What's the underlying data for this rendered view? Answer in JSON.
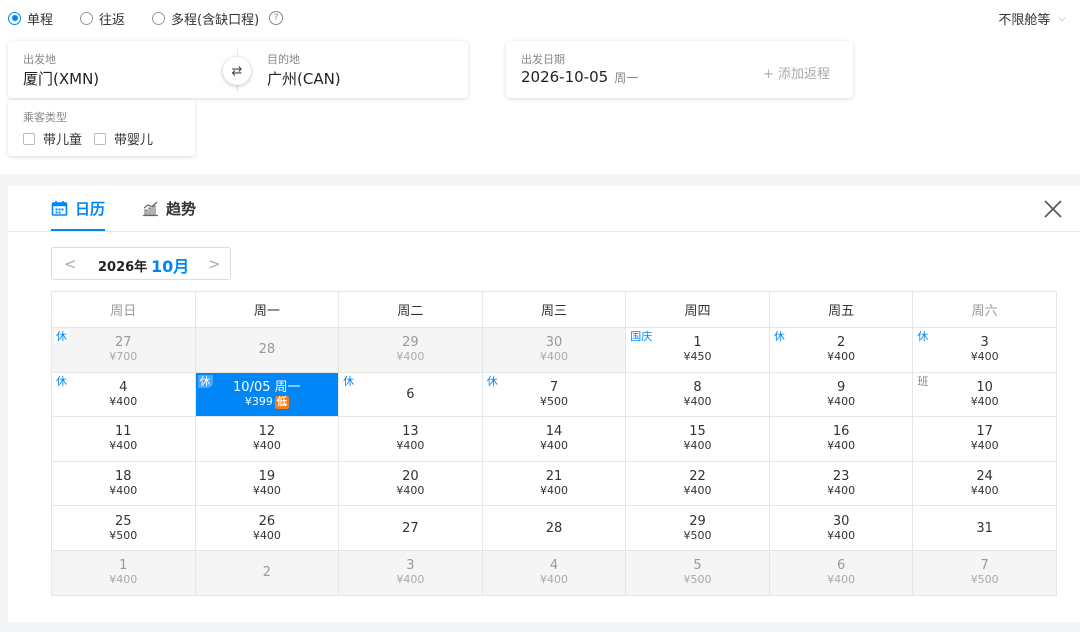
{
  "trip_types": [
    {
      "label": "单程",
      "selected": true
    },
    {
      "label": "往返",
      "selected": false
    },
    {
      "label": "多程(含缺口程)",
      "selected": false
    }
  ],
  "help_glyph": "?",
  "cabin": {
    "label": "不限舱等",
    "chevron": "⌵"
  },
  "route": {
    "from_label": "出发地",
    "from_value": "厦门(XMN)",
    "to_label": "目的地",
    "to_value": "广州(CAN)",
    "swap_glyph": "⇄"
  },
  "dates": {
    "depart_label": "出发日期",
    "depart_value": "2026-10-05",
    "depart_weekday": "周一",
    "add_return": "+ 添加返程"
  },
  "passengers": {
    "label": "乘客类型",
    "options": [
      "带儿童",
      "带婴儿"
    ]
  },
  "tabs": [
    {
      "label": "日历",
      "active": true,
      "icon": "calendar-icon"
    },
    {
      "label": "趋势",
      "active": false,
      "icon": "trend-chart-icon"
    }
  ],
  "month_nav": {
    "prev": "<",
    "next": ">",
    "year": "2026年",
    "month": "10月"
  },
  "weekdays": [
    "周日",
    "周一",
    "周二",
    "周三",
    "周四",
    "周五",
    "周六"
  ],
  "calendar": [
    [
      {
        "day": "27",
        "price": "¥700",
        "tag": "休",
        "grey": true
      },
      {
        "day": "28",
        "price": "",
        "tag": "",
        "grey": true
      },
      {
        "day": "29",
        "price": "¥400",
        "tag": "",
        "grey": true
      },
      {
        "day": "30",
        "price": "¥400",
        "tag": "",
        "grey": true
      },
      {
        "day": "1",
        "price": "¥450",
        "tag": "国庆"
      },
      {
        "day": "2",
        "price": "¥400",
        "tag": "休"
      },
      {
        "day": "3",
        "price": "¥400",
        "tag": "休"
      }
    ],
    [
      {
        "day": "4",
        "price": "¥400",
        "tag": "休"
      },
      {
        "day": "10/05 周一",
        "price": "¥399",
        "tag": "休",
        "selected": true,
        "low": "低"
      },
      {
        "day": "6",
        "price": "",
        "tag": "休"
      },
      {
        "day": "7",
        "price": "¥500",
        "tag": "休"
      },
      {
        "day": "8",
        "price": "¥400",
        "tag": ""
      },
      {
        "day": "9",
        "price": "¥400",
        "tag": ""
      },
      {
        "day": "10",
        "price": "¥400",
        "tag": "班"
      }
    ],
    [
      {
        "day": "11",
        "price": "¥400"
      },
      {
        "day": "12",
        "price": "¥400"
      },
      {
        "day": "13",
        "price": "¥400"
      },
      {
        "day": "14",
        "price": "¥400"
      },
      {
        "day": "15",
        "price": "¥400"
      },
      {
        "day": "16",
        "price": "¥400"
      },
      {
        "day": "17",
        "price": "¥400"
      }
    ],
    [
      {
        "day": "18",
        "price": "¥400"
      },
      {
        "day": "19",
        "price": "¥400"
      },
      {
        "day": "20",
        "price": "¥400"
      },
      {
        "day": "21",
        "price": "¥400"
      },
      {
        "day": "22",
        "price": "¥400"
      },
      {
        "day": "23",
        "price": "¥400"
      },
      {
        "day": "24",
        "price": "¥400"
      }
    ],
    [
      {
        "day": "25",
        "price": "¥500"
      },
      {
        "day": "26",
        "price": "¥400"
      },
      {
        "day": "27",
        "price": ""
      },
      {
        "day": "28",
        "price": ""
      },
      {
        "day": "29",
        "price": "¥500"
      },
      {
        "day": "30",
        "price": "¥400"
      },
      {
        "day": "31",
        "price": ""
      }
    ],
    [
      {
        "day": "1",
        "price": "¥400",
        "grey": true
      },
      {
        "day": "2",
        "price": "",
        "grey": true
      },
      {
        "day": "3",
        "price": "¥400",
        "grey": true
      },
      {
        "day": "4",
        "price": "¥400",
        "grey": true
      },
      {
        "day": "5",
        "price": "¥500",
        "grey": true
      },
      {
        "day": "6",
        "price": "¥400",
        "grey": true
      },
      {
        "day": "7",
        "price": "¥500",
        "grey": true
      }
    ]
  ],
  "colors": {
    "accent": "#0086f6",
    "low_badge": "#ff7d13"
  }
}
